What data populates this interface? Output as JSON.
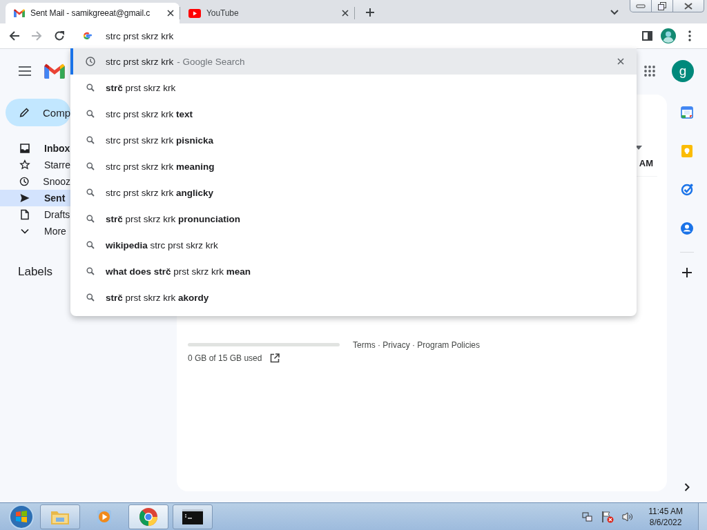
{
  "browser": {
    "tabs": [
      {
        "title": "Sent Mail - samikgreeat@gmail.c",
        "kind": "gmail",
        "selected": true
      },
      {
        "title": "YouTube",
        "kind": "youtube",
        "selected": false
      }
    ],
    "omnibox": {
      "value": "strc prst skrz krk"
    },
    "suggestions": [
      {
        "kind": "history",
        "text": "strc prst skrz krk",
        "suffix": "- Google Search",
        "selected": true
      },
      {
        "kind": "search",
        "text": "**strč** prst skrz krk",
        "selected": false
      },
      {
        "kind": "search",
        "text": "strc prst skrz krk **text**",
        "selected": false
      },
      {
        "kind": "search",
        "text": "strc prst skrz krk **pisnicka**",
        "selected": false
      },
      {
        "kind": "search",
        "text": "strc prst skrz krk **meaning**",
        "selected": false
      },
      {
        "kind": "search",
        "text": "strc prst skrz krk **anglicky**",
        "selected": false
      },
      {
        "kind": "search",
        "text": "**strč** prst skrz krk **pronunciation**",
        "selected": false
      },
      {
        "kind": "search",
        "text": "**wikipedia** strc prst skrz krk",
        "selected": false
      },
      {
        "kind": "search",
        "text": "**what does strč** prst skrz krk **mean**",
        "selected": false
      },
      {
        "kind": "search",
        "text": "**strč** prst skrz krk **akordy**",
        "selected": false
      }
    ]
  },
  "gmail": {
    "avatar": "g",
    "compose": {
      "label": "Comp"
    },
    "nav": [
      {
        "kind": "inbox",
        "label": "Inbox",
        "unread": true,
        "selected": false
      },
      {
        "kind": "starred",
        "label": "Starre",
        "unread": false,
        "selected": false
      },
      {
        "kind": "snoozed",
        "label": "Snooz",
        "unread": false,
        "selected": false
      },
      {
        "kind": "sent",
        "label": "Sent",
        "unread": false,
        "selected": true
      },
      {
        "kind": "drafts",
        "label": "Drafts",
        "unread": false,
        "selected": false
      },
      {
        "kind": "more",
        "label": "More",
        "unread": false,
        "selected": false
      }
    ],
    "labels_heading": "Labels",
    "list_header": {
      "column_1": "AM"
    },
    "storage": {
      "level": 0,
      "text": "0 GB of 15 GB used"
    },
    "footer": "Terms · Privacy · Program Policies"
  },
  "taskbar": {
    "apps": [
      {
        "kind": "explorer",
        "running": true,
        "active": false
      },
      {
        "kind": "media",
        "running": false,
        "active": false
      },
      {
        "kind": "chrome",
        "running": true,
        "active": true
      },
      {
        "kind": "console",
        "running": true,
        "active": false
      }
    ],
    "clock": {
      "time": "11:45 AM",
      "date": "8/6/2022"
    }
  }
}
